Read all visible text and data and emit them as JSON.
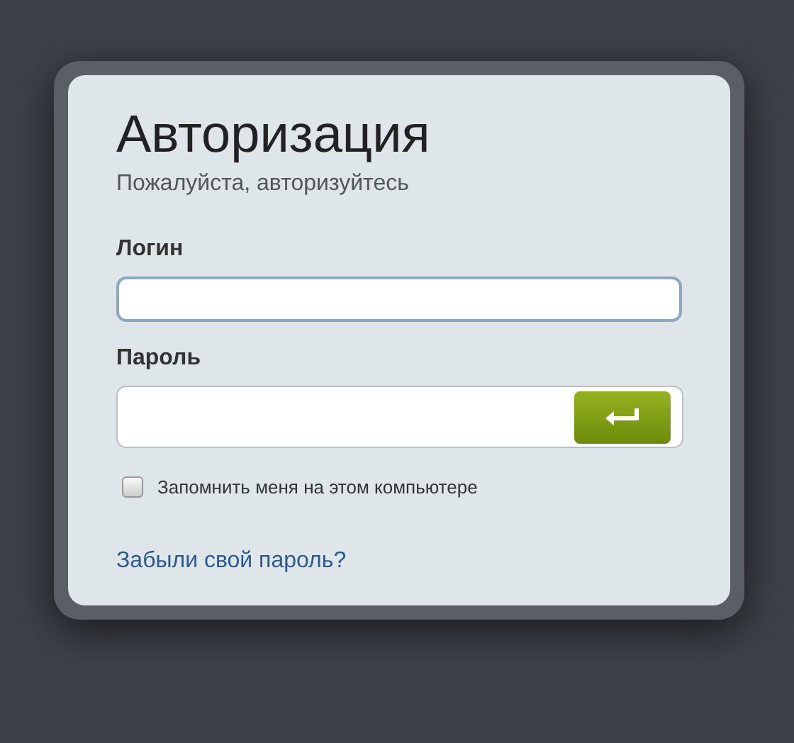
{
  "title": "Авторизация",
  "subtitle": "Пожалуйста, авторизуйтесь",
  "login": {
    "label": "Логин"
  },
  "password": {
    "label": "Пароль"
  },
  "remember": {
    "label": "Запомнить меня на этом компьютере",
    "checked": false
  },
  "forgot_link": "Забыли свой пароль?"
}
